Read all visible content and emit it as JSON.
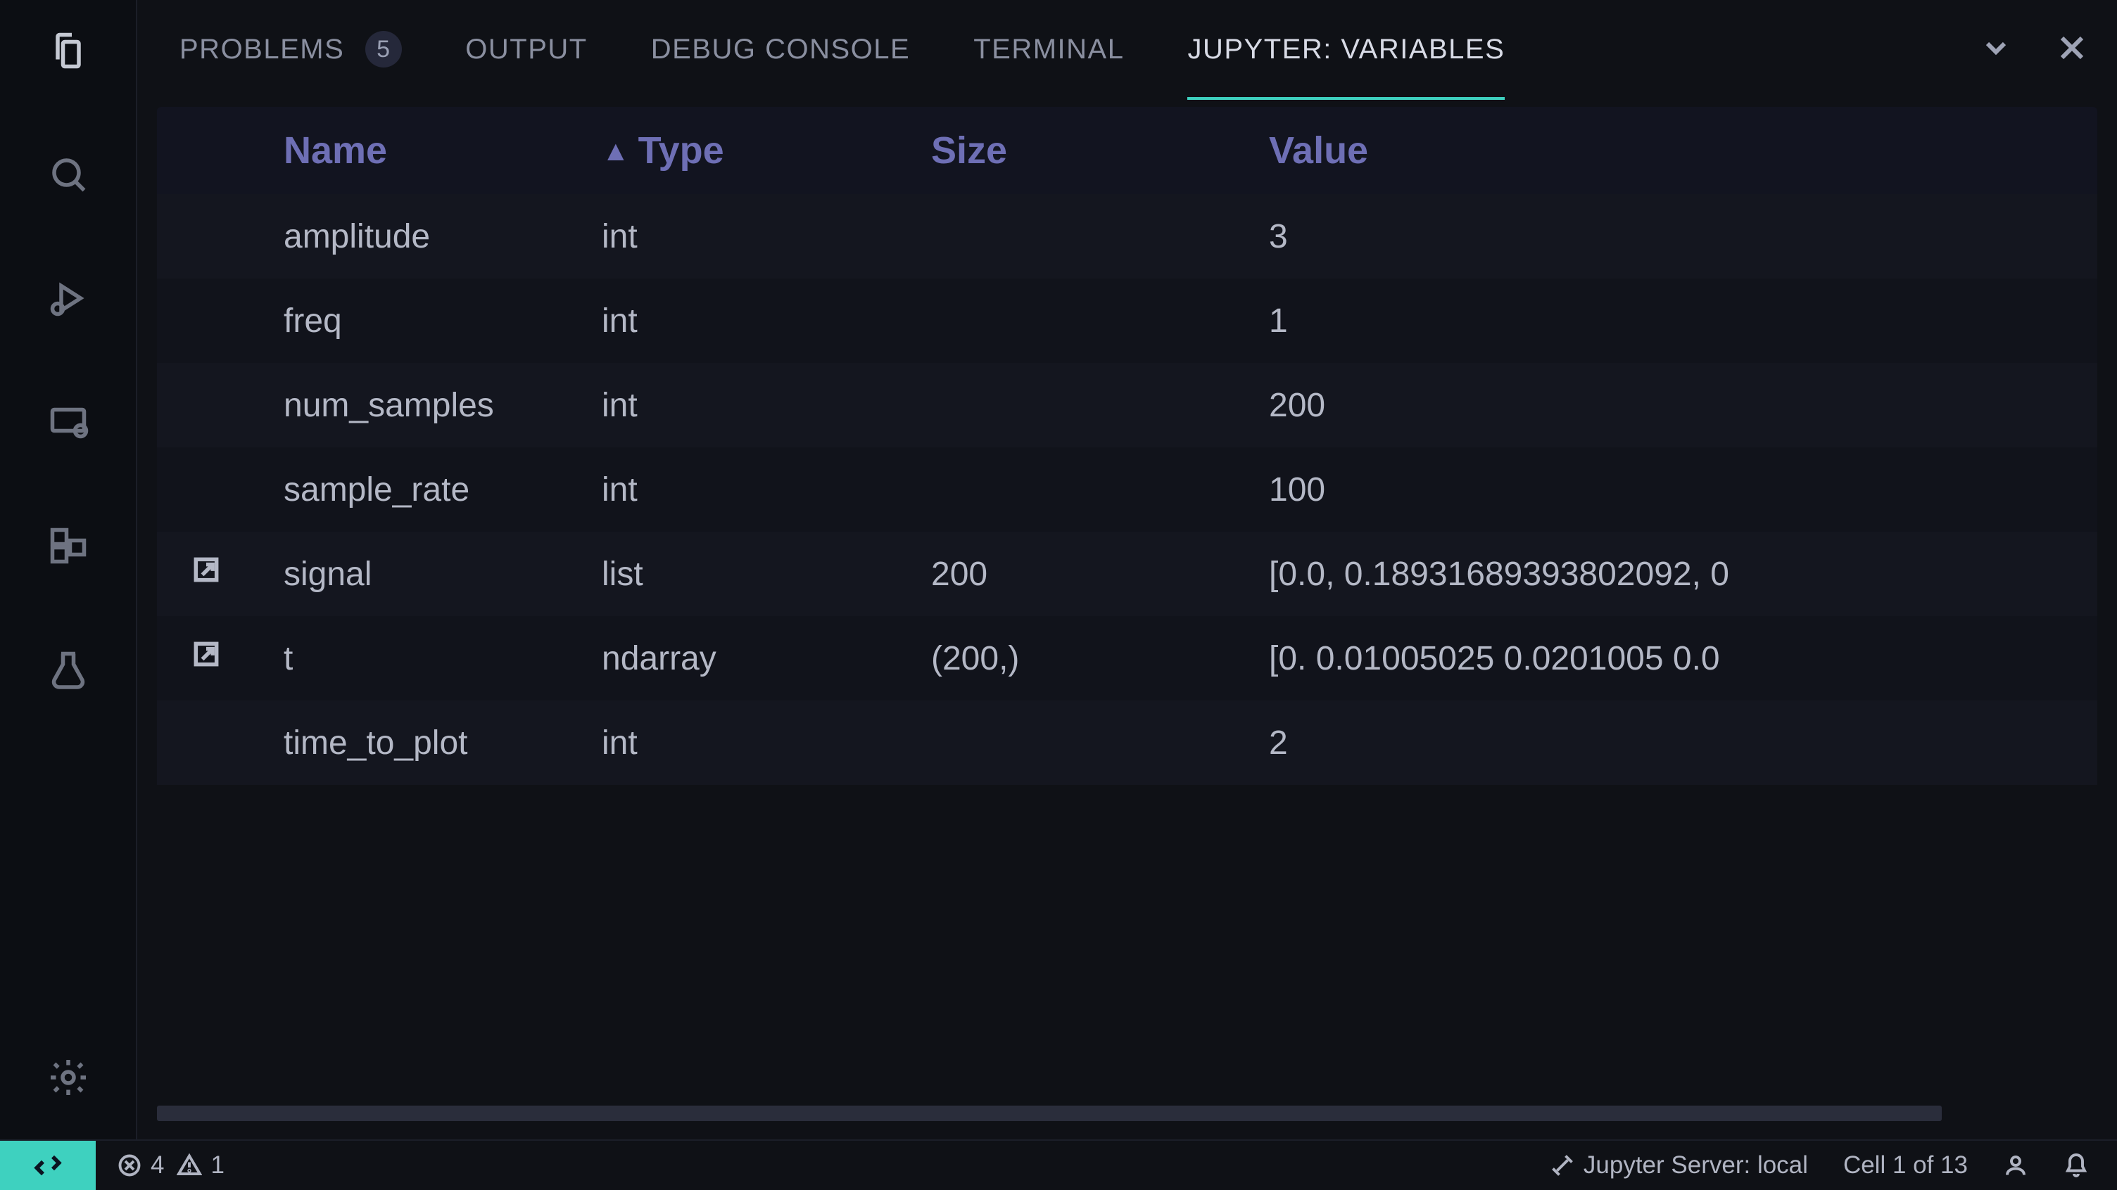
{
  "panel": {
    "tabs": [
      {
        "label": "PROBLEMS",
        "badge": "5",
        "active": false
      },
      {
        "label": "OUTPUT",
        "badge": null,
        "active": false
      },
      {
        "label": "DEBUG CONSOLE",
        "badge": null,
        "active": false
      },
      {
        "label": "TERMINAL",
        "badge": null,
        "active": false
      },
      {
        "label": "JUPYTER: VARIABLES",
        "badge": null,
        "active": true
      }
    ]
  },
  "vars_table": {
    "headers": {
      "name": "Name",
      "type": "Type",
      "size": "Size",
      "value": "Value"
    },
    "sort": {
      "column": "type",
      "direction": "asc"
    },
    "rows": [
      {
        "expandable": false,
        "name": "amplitude",
        "type": "int",
        "size": "",
        "value": "3"
      },
      {
        "expandable": false,
        "name": "freq",
        "type": "int",
        "size": "",
        "value": "1"
      },
      {
        "expandable": false,
        "name": "num_samples",
        "type": "int",
        "size": "",
        "value": "200"
      },
      {
        "expandable": false,
        "name": "sample_rate",
        "type": "int",
        "size": "",
        "value": "100"
      },
      {
        "expandable": true,
        "name": "signal",
        "type": "list",
        "size": "200",
        "value": "[0.0, 0.18931689393802092, 0"
      },
      {
        "expandable": true,
        "name": "t",
        "type": "ndarray",
        "size": "(200,)",
        "value": "[0. 0.01005025 0.0201005 0.0"
      },
      {
        "expandable": false,
        "name": "time_to_plot",
        "type": "int",
        "size": "",
        "value": "2"
      }
    ]
  },
  "status": {
    "errors": "4",
    "warnings": "1",
    "jupyter_server": "Jupyter Server: local",
    "cell_position": "Cell 1 of 13"
  }
}
